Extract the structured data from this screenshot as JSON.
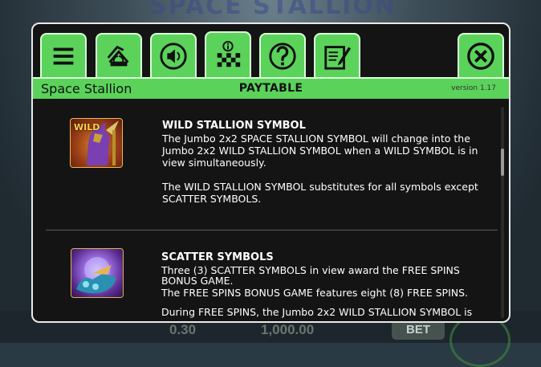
{
  "background": {
    "title": "SPACE STALLION",
    "values": [
      "0.30",
      "1,000.00"
    ],
    "bet_label": "BET"
  },
  "tabs": [
    {
      "name": "menu",
      "icon": "menu-icon"
    },
    {
      "name": "autoplay",
      "icon": "autoplay-icon"
    },
    {
      "name": "sound",
      "icon": "speaker-icon"
    },
    {
      "name": "paytable",
      "icon": "paytable-icon",
      "active": true
    },
    {
      "name": "help",
      "icon": "help-icon"
    },
    {
      "name": "history",
      "icon": "edit-notes-icon"
    },
    {
      "name": "close",
      "icon": "close-icon"
    }
  ],
  "header": {
    "game_name": "Space Stallion",
    "page_title": "PAYTABLE",
    "version": "version 1.17"
  },
  "sections": {
    "wild": {
      "title": "WILD STALLION SYMBOL",
      "icon_label": "WILD",
      "paragraph1": "The Jumbo 2x2 SPACE STALLION SYMBOL will change into the Jumbo 2x2 WILD STALLION SYMBOL when a WILD SYMBOL is in view simultaneously.",
      "paragraph2": "The WILD STALLION SYMBOL substitutes for all symbols except SCATTER SYMBOLS."
    },
    "scatter": {
      "title": "SCATTER SYMBOLS",
      "paragraph1": "Three (3) SCATTER SYMBOLS in view award the FREE SPINS BONUS GAME.",
      "paragraph2": "The FREE SPINS BONUS GAME features eight (8) FREE SPINS.",
      "paragraph3": "During FREE SPINS, the Jumbo 2x2 WILD STALLION SYMBOL is"
    }
  },
  "colors": {
    "accent_green": "#5bd35b",
    "panel_bg": "#141414"
  }
}
